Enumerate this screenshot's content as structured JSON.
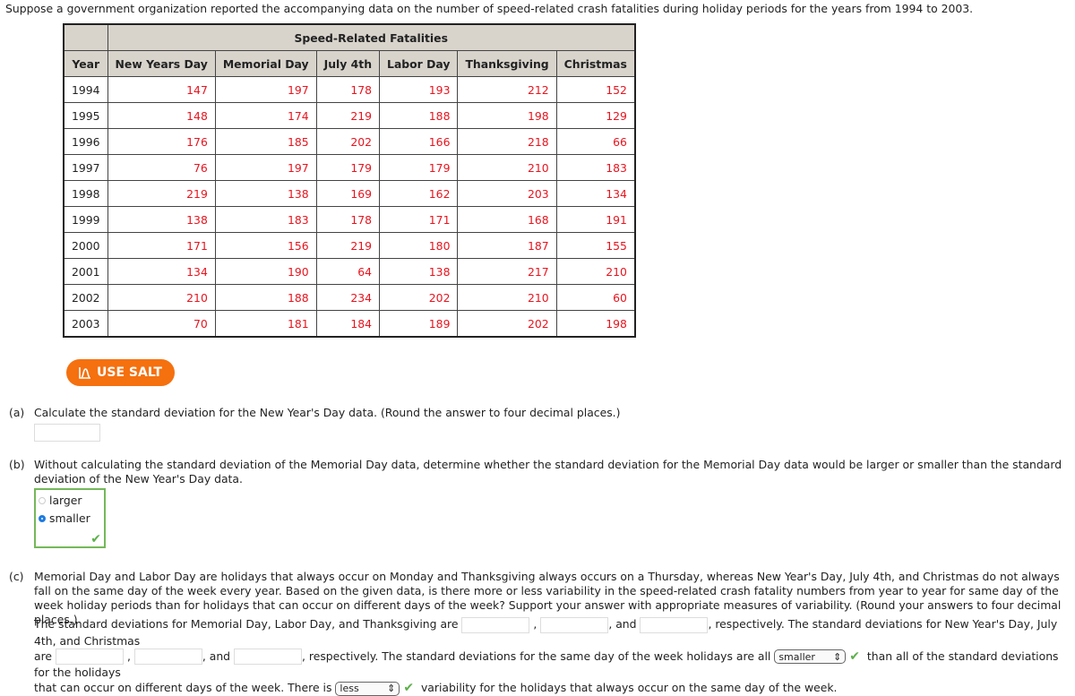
{
  "intro": "Suppose a government organization reported the accompanying data on the number of speed-related crash fatalities during holiday periods for the years from 1994 to 2003.",
  "table": {
    "group_header": "Speed-Related Fatalities",
    "columns": [
      "Year",
      "New Years Day",
      "Memorial Day",
      "July 4th",
      "Labor Day",
      "Thanksgiving",
      "Christmas"
    ],
    "rows": [
      [
        "1994",
        "147",
        "197",
        "178",
        "193",
        "212",
        "152"
      ],
      [
        "1995",
        "148",
        "174",
        "219",
        "188",
        "198",
        "129"
      ],
      [
        "1996",
        "176",
        "185",
        "202",
        "166",
        "218",
        "66"
      ],
      [
        "1997",
        "76",
        "197",
        "179",
        "179",
        "210",
        "183"
      ],
      [
        "1998",
        "219",
        "138",
        "169",
        "162",
        "203",
        "134"
      ],
      [
        "1999",
        "138",
        "183",
        "178",
        "171",
        "168",
        "191"
      ],
      [
        "2000",
        "171",
        "156",
        "219",
        "180",
        "187",
        "155"
      ],
      [
        "2001",
        "134",
        "190",
        "64",
        "138",
        "217",
        "210"
      ],
      [
        "2002",
        "210",
        "188",
        "234",
        "202",
        "210",
        "60"
      ],
      [
        "2003",
        "70",
        "181",
        "184",
        "189",
        "202",
        "198"
      ]
    ],
    "value_color": "#e8141e"
  },
  "salt_button": "USE SALT",
  "part_a": {
    "label": "(a)",
    "text": "Calculate the standard deviation for the New Year's Day data. (Round the answer to four decimal places.)",
    "answer": ""
  },
  "part_b": {
    "label": "(b)",
    "text": "Without calculating the standard deviation of the Memorial Day data, determine whether the standard deviation for the Memorial Day data would be larger or smaller than the standard deviation of the New Year's Day data.",
    "options": [
      "larger",
      "smaller"
    ],
    "selected": "smaller"
  },
  "part_c": {
    "label": "(c)",
    "text": "Memorial Day and Labor Day are holidays that always occur on Monday and Thanksgiving always occurs on a Thursday, whereas New Year's Day, July 4th, and Christmas do not always fall on the same day of the week every year. Based on the given data, is there more or less variability in the speed-related crash fatality numbers from year to year for same day of the week holiday periods than for holidays that can occur on different days of the week? Support your answer with appropriate measures of variability. (Round your answers to four decimal places.)",
    "s1": "The standard deviations for Memorial Day, Labor Day, and Thanksgiving are",
    "comma": ",",
    "and": ", and",
    "s2": ", respectively. The standard deviations for New Year's Day, July 4th, and Christmas",
    "are": "are",
    "s3": ", respectively. The standard deviations for the same day of the week holidays are all",
    "select1": "smaller",
    "s4": "than all of the standard deviations for the holidays",
    "s5": "that can occur on different days of the week. There is",
    "select2": "less",
    "s6": "variability for the holidays that always occur on the same day of the week."
  }
}
